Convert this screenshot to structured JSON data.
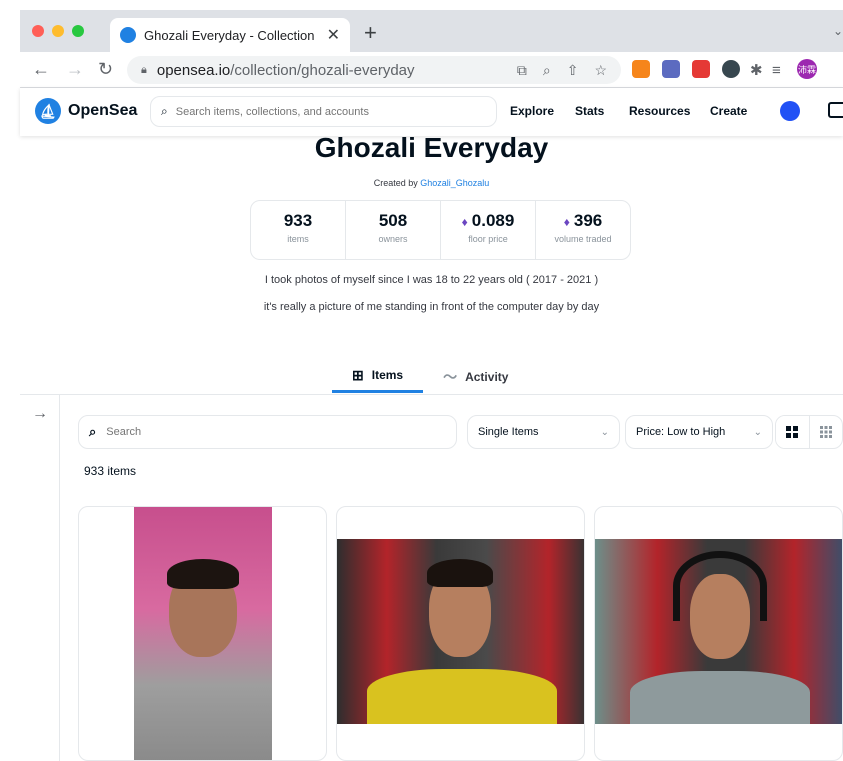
{
  "browser": {
    "tab_title": "Ghozali Everyday - Collection | ",
    "tab_close": "✕",
    "new_tab": "+",
    "url_host": "opensea.io",
    "url_path": "/collection/ghozali-everyday",
    "profile_initials": "沛霖"
  },
  "header": {
    "brand": "OpenSea",
    "search_placeholder": "Search items, collections, and accounts",
    "nav": [
      "Explore",
      "Stats",
      "Resources",
      "Create"
    ]
  },
  "collection": {
    "title": "Ghozali Everyday",
    "created_by_prefix": "Created by ",
    "creator": "Ghozali_Ghozalu",
    "stats": [
      {
        "value": "933",
        "label": "items",
        "eth": false
      },
      {
        "value": "508",
        "label": "owners",
        "eth": false
      },
      {
        "value": "0.089",
        "label": "floor price",
        "eth": true
      },
      {
        "value": "396",
        "label": "volume traded",
        "eth": true
      }
    ],
    "description_line1": "I took photos of myself since I was 18 to 22 years old ( 2017 - 2021 )",
    "description_line2": "it's really a picture of me standing in front of the computer day by day"
  },
  "tabs": [
    {
      "label": "Items",
      "active": true
    },
    {
      "label": "Activity",
      "active": false
    }
  ],
  "filters": {
    "search_placeholder": "Search",
    "type_select": "Single Items",
    "sort_select": "Price: Low to High"
  },
  "results": {
    "count_label": "933 items"
  },
  "colors": {
    "accent": "#2081e2",
    "eth": "#6b46c1"
  }
}
